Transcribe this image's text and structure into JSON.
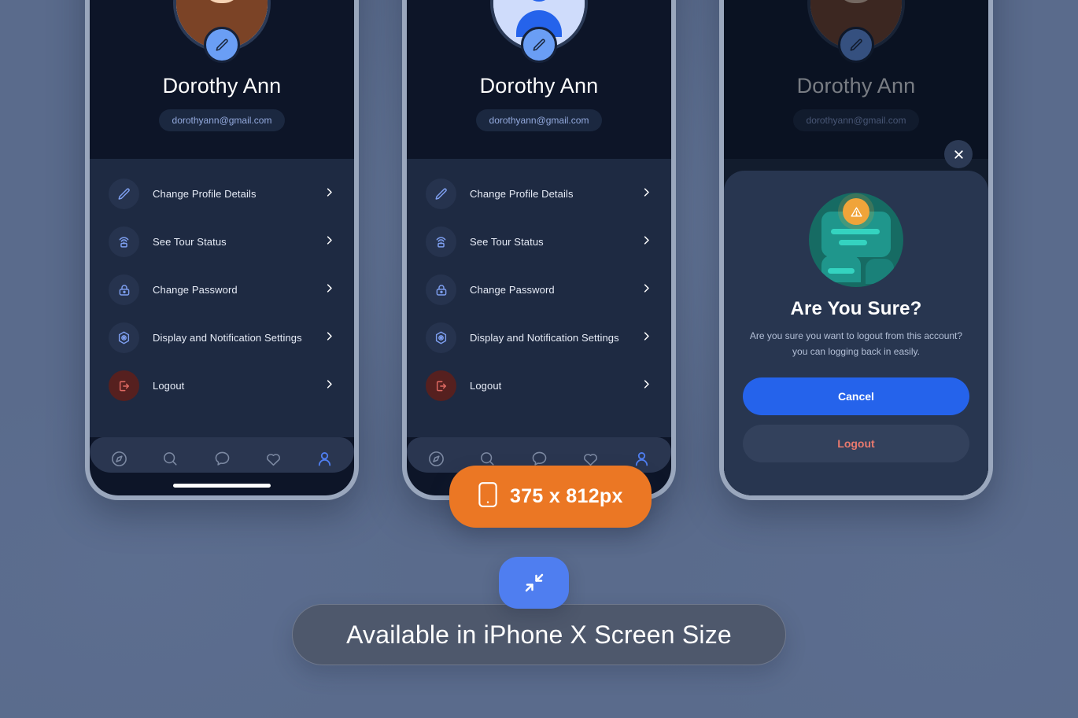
{
  "background": {
    "color": "#5a6b8c"
  },
  "profile": {
    "name": "Dorothy Ann",
    "email": "dorothyann@gmail.com",
    "avatar_icon": "user-avatar-photo",
    "edit_icon": "pencil-icon"
  },
  "menu": {
    "items": [
      {
        "label": "Change Profile Details",
        "icon": "pencil-icon",
        "tone": "normal"
      },
      {
        "label": "See Tour Status",
        "icon": "broadcast-tour-icon",
        "tone": "normal"
      },
      {
        "label": "Change Password",
        "icon": "lock-icon",
        "tone": "normal"
      },
      {
        "label": "Display and Notification Settings",
        "icon": "hex-gear-icon",
        "tone": "normal"
      },
      {
        "label": "Logout",
        "icon": "logout-door-icon",
        "tone": "danger"
      }
    ],
    "chevron_icon": "chevron-right-icon"
  },
  "bottom_nav": {
    "items": [
      {
        "name": "compass-icon",
        "active": false
      },
      {
        "name": "search-icon",
        "active": false
      },
      {
        "name": "chat-bubble-icon",
        "active": false
      },
      {
        "name": "heart-icon",
        "active": false
      },
      {
        "name": "profile-person-icon",
        "active": true
      }
    ],
    "active_color": "#4f7ef0",
    "inactive_color": "#7d8aa3"
  },
  "dialog": {
    "close_icon": "close-x-icon",
    "illustration_icon": "warning-message-illustration",
    "warning_icon": "warning-triangle-icon",
    "title": "Are You Sure?",
    "body": "Are you sure you want to logout from this account? you can logging back in easily.",
    "primary_label": "Cancel",
    "secondary_label": "Logout",
    "primary_color": "#2563eb",
    "secondary_text_color": "#e8796e"
  },
  "size_badge": {
    "text": "375 x 812px",
    "icon": "phone-device-icon",
    "color": "#eb7724"
  },
  "caption": {
    "text": "Available in iPhone X Screen Size",
    "icon": "compress-arrows-icon",
    "icon_color": "#4f7ef0"
  }
}
